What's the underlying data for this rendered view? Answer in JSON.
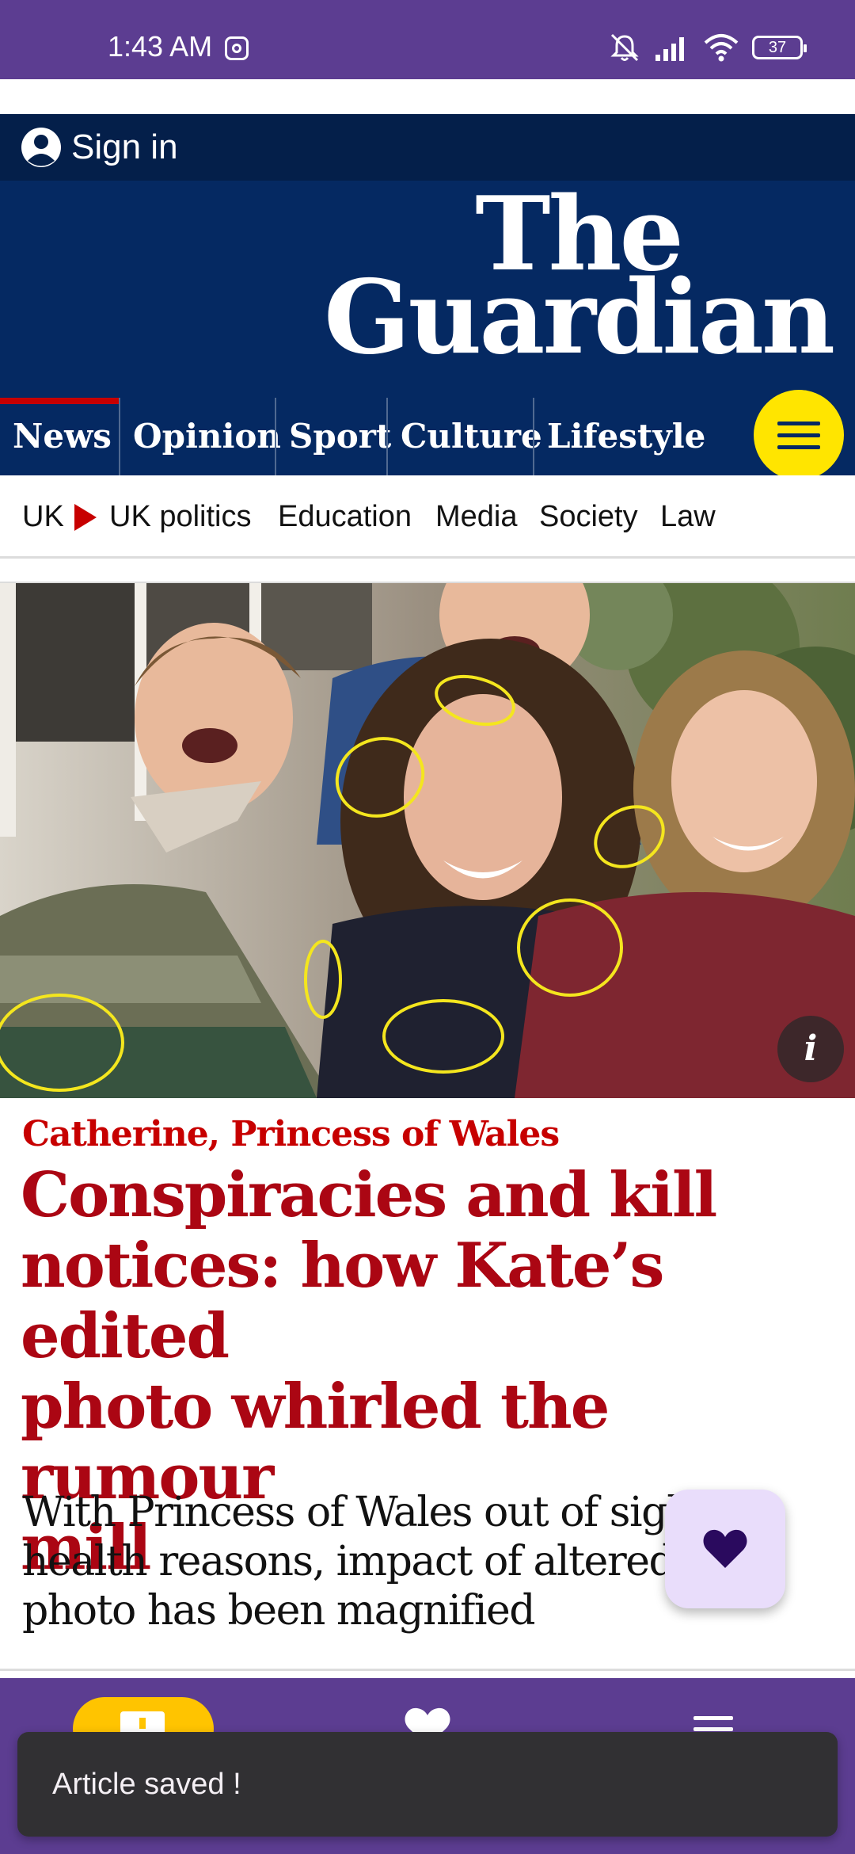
{
  "status_bar": {
    "time": "1:43 AM",
    "battery": "37",
    "icons": [
      "instagram-icon",
      "mute-icon",
      "signal-icon",
      "wifi-icon",
      "battery-icon"
    ]
  },
  "header": {
    "sign_in_label": "Sign in",
    "logo_line1": "The",
    "logo_line2": "Guardian"
  },
  "pillars": [
    {
      "label": "News",
      "active": true
    },
    {
      "label": "Opinion",
      "active": false
    },
    {
      "label": "Sport",
      "active": false
    },
    {
      "label": "Culture",
      "active": false
    },
    {
      "label": "Lifestyle",
      "active": false
    }
  ],
  "subnav": [
    "UK",
    "UK politics",
    "Education",
    "Media",
    "Society",
    "Law"
  ],
  "article": {
    "kicker": "Catherine, Princess of Wales",
    "headline_lines": [
      "Conspiracies and kill",
      "notices: how Kate’s edited",
      "photo whirled the rumour",
      "mill"
    ],
    "standfirst_lines": [
      "With Princess of Wales out of sight",
      "health reasons, impact of altered fa",
      "photo has been magnified"
    ],
    "image_info_label": "i"
  },
  "bottom_nav": {
    "items": [
      "news-icon",
      "heart-icon",
      "menu-icon"
    ]
  },
  "snackbar": {
    "message": "Article saved !"
  },
  "colors": {
    "system_purple": "#5c3d91",
    "guardian_navy": "#052962",
    "guardian_dark_navy": "#041f4a",
    "guardian_red": "#c70000",
    "headline_red": "#ab0613",
    "menu_yellow": "#ffe500",
    "fab_bg": "#e9ddfb",
    "snackbar_bg": "#313033"
  }
}
